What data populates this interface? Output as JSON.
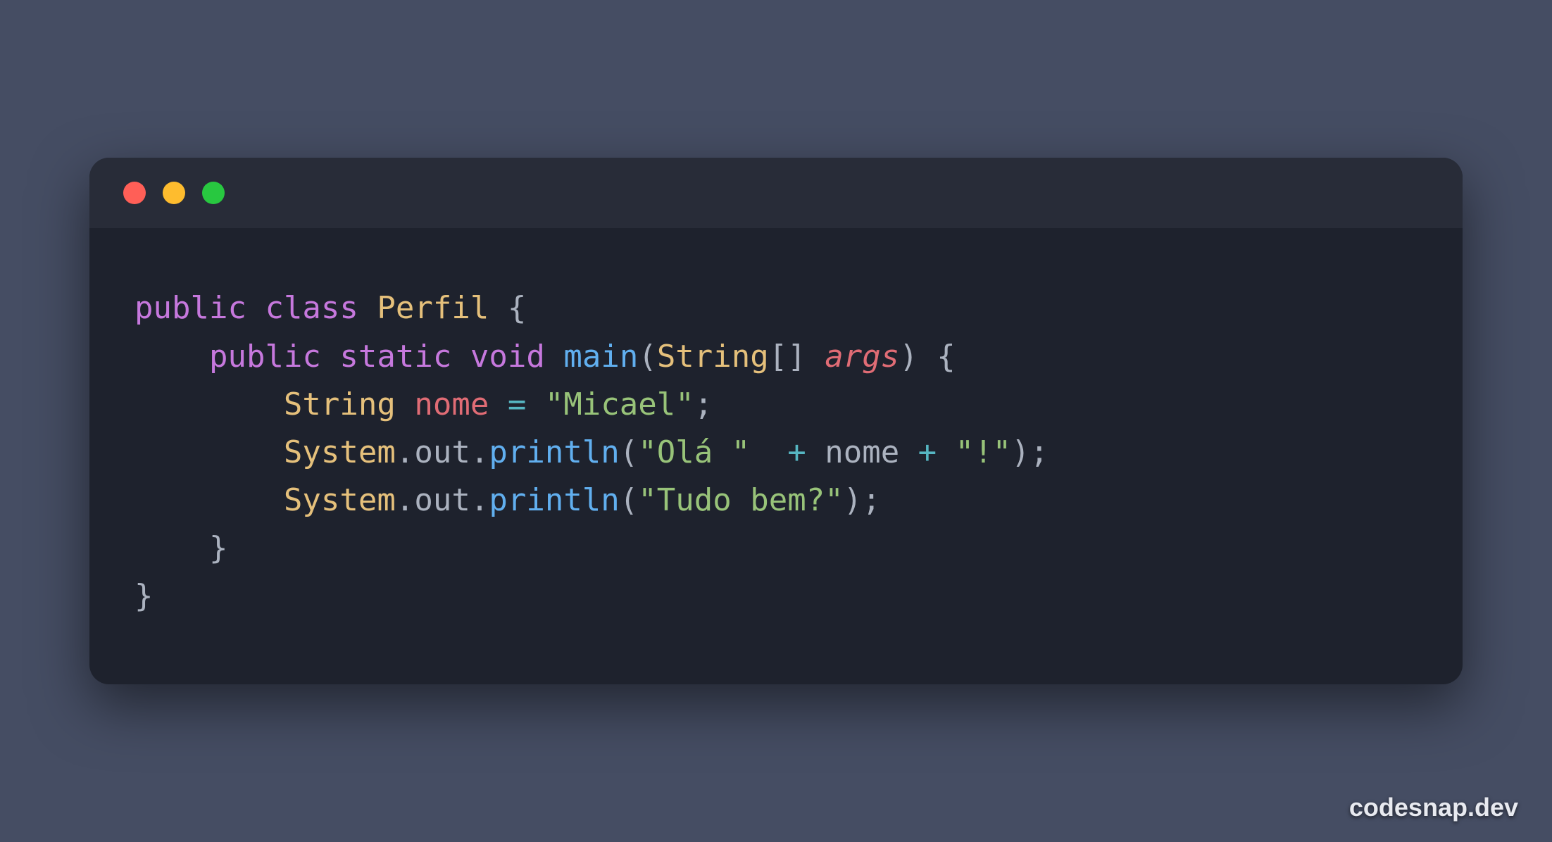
{
  "watermark": "codesnap.dev",
  "traffic_lights": {
    "close": "close",
    "minimize": "minimize",
    "zoom": "zoom"
  },
  "code": {
    "line1": {
      "kw_public": "public",
      "kw_class": "class",
      "class_name": "Perfil",
      "brace_open": " {"
    },
    "line2": {
      "indent": "    ",
      "kw_public": "public",
      "kw_static": "static",
      "kw_void": "void",
      "method": "main",
      "paren_open": "(",
      "type": "String",
      "brackets": "[] ",
      "param": "args",
      "paren_close": ")",
      "brace_open": " {"
    },
    "line3": {
      "indent": "        ",
      "type": "String",
      "var": "nome",
      "eq": " = ",
      "str": "\"Micael\"",
      "semi": ";"
    },
    "line4": {
      "indent": "        ",
      "obj1": "System",
      "dot1": ".",
      "obj2": "out",
      "dot2": ".",
      "method": "println",
      "paren_open": "(",
      "str1": "\"Olá \"",
      "plus1": "  + ",
      "var": "nome",
      "plus2": " + ",
      "str2": "\"!\"",
      "paren_close": ")",
      "semi": ";"
    },
    "line5": {
      "indent": "        ",
      "obj1": "System",
      "dot1": ".",
      "obj2": "out",
      "dot2": ".",
      "method": "println",
      "paren_open": "(",
      "str": "\"Tudo bem?\"",
      "paren_close": ")",
      "semi": ";"
    },
    "line6": {
      "indent": "    ",
      "brace_close": "}"
    },
    "line7": {
      "brace_close": "}"
    }
  }
}
